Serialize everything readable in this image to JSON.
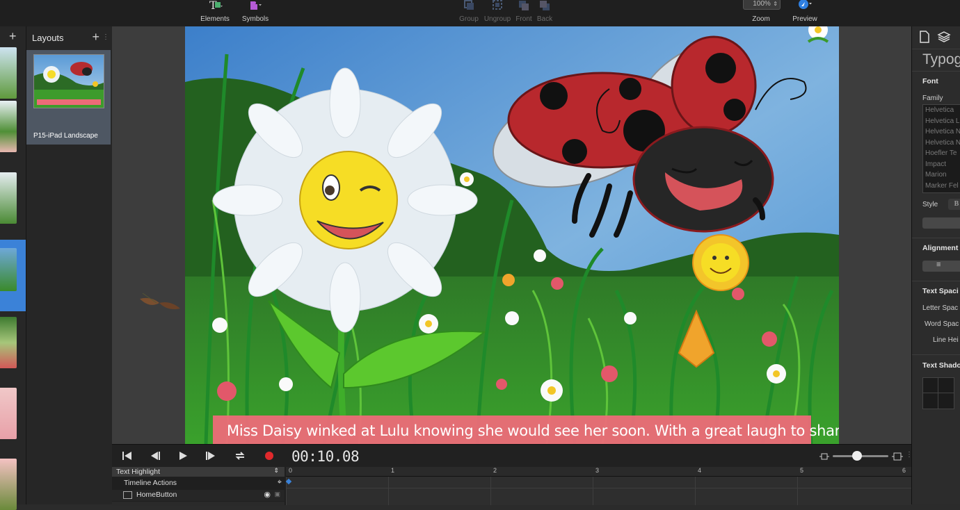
{
  "toolbar": {
    "elements_label": "Elements",
    "symbols_label": "Symbols",
    "group_label": "Group",
    "ungroup_label": "Ungroup",
    "front_label": "Front",
    "back_label": "Back",
    "zoom_value": "100%",
    "zoom_label": "Zoom",
    "preview_label": "Preview"
  },
  "layouts": {
    "title": "Layouts",
    "add_label": "+",
    "items": [
      {
        "label": "P15-iPad Landscape"
      }
    ]
  },
  "pages": {
    "add_label": "+"
  },
  "canvas": {
    "caption": "Miss Daisy winked at Lulu knowing she would see her soon.  With a great laugh to share, Miss Daisy"
  },
  "inspector": {
    "title": "Typog",
    "font_section": "Font",
    "family_label": "Family",
    "fonts": [
      "Helvetica",
      "Helvetica L",
      "Helvetica N",
      "Helvetica N",
      "Hoefler Te",
      "Impact",
      "Marion",
      "Marker Fel"
    ],
    "style_label": "Style",
    "bold_glyph": "B",
    "alignment_section": "Alignment",
    "text_spacing_section": "Text Spaci",
    "letter_spacing_label": "Letter Spac",
    "word_spacing_label": "Word Spac",
    "line_height_label": "Line Hei",
    "text_shadow_section": "Text Shado"
  },
  "timeline": {
    "time": "00:10.08",
    "selected_track": "Text Highlight",
    "rows": [
      "Timeline Actions",
      "HomeButton"
    ],
    "ruler_marks": [
      "0",
      "1",
      "2",
      "3",
      "4",
      "5",
      "6"
    ]
  },
  "colors": {
    "accent": "#3b82d8",
    "record": "#e0292c",
    "caption_bg": "#ec6b78"
  }
}
